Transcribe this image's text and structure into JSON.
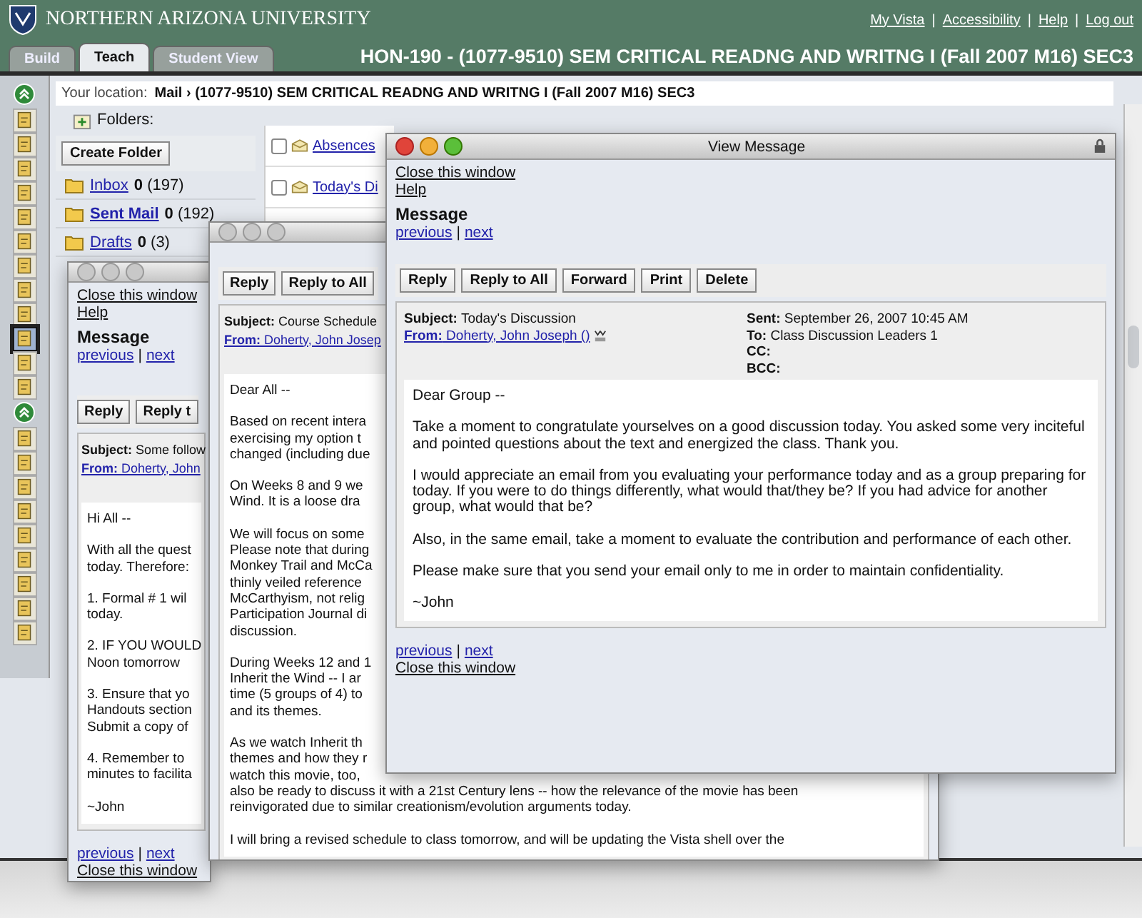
{
  "header": {
    "university": "NORTHERN ARIZONA UNIVERSITY",
    "links": [
      "My Vista",
      "Accessibility",
      "Help",
      "Log out"
    ],
    "link_separator": "|"
  },
  "tabs": [
    {
      "label": "Build",
      "selected": false
    },
    {
      "label": "Teach",
      "selected": true
    },
    {
      "label": "Student View",
      "selected": false
    }
  ],
  "course_title": "HON-190 - (1077-9510) SEM CRITICAL READNG AND WRITNG I (Fall 2007 M16) SEC3",
  "tool_groups": [
    {
      "tools": [
        {
          "selected": false
        },
        {
          "selected": false
        },
        {
          "selected": false
        },
        {
          "selected": false
        },
        {
          "selected": false
        },
        {
          "selected": false
        },
        {
          "selected": false
        },
        {
          "selected": false
        },
        {
          "selected": false
        },
        {
          "selected": true
        },
        {
          "selected": false
        },
        {
          "selected": false
        }
      ]
    },
    {
      "tools": [
        {
          "selected": false
        },
        {
          "selected": false
        },
        {
          "selected": false
        },
        {
          "selected": false
        },
        {
          "selected": false
        },
        {
          "selected": false
        },
        {
          "selected": false
        },
        {
          "selected": false
        },
        {
          "selected": false
        }
      ]
    }
  ],
  "location": {
    "label": "Your location:",
    "path": "Mail › (1077-9510) SEM CRITICAL READNG AND WRITNG I (Fall 2007 M16) SEC3"
  },
  "folders": {
    "label": "Folders:",
    "create_button": "Create Folder",
    "items": [
      {
        "name": "Inbox",
        "unread": "0",
        "total": "(197)",
        "selected": false
      },
      {
        "name": "Sent Mail",
        "unread": "0",
        "total": "(192)",
        "selected": true
      },
      {
        "name": "Drafts",
        "unread": "0",
        "total": "(3)",
        "selected": false
      }
    ]
  },
  "message_list": [
    {
      "subject": "Absences",
      "checked": false
    },
    {
      "subject": "Today's Di",
      "checked": false
    }
  ],
  "windows": [
    {
      "active": false,
      "close_link": "Close this window",
      "help_link": "Help",
      "heading": "Message",
      "nav": {
        "previous": "previous",
        "separator": "|",
        "next": "next"
      },
      "buttons": [
        "Reply",
        "Reply t"
      ],
      "subject_label": "Subject:",
      "subject": "Some follow",
      "from_label": "From:",
      "from": "Doherty, John",
      "paragraphs": [
        [
          "Hi All --"
        ],
        [
          "With all the quest",
          "today. Therefore:"
        ],
        [
          "1. Formal # 1 wil",
          "today."
        ],
        [
          "2. IF YOU WOULD",
          "Noon tomorrow"
        ],
        [
          "3. Ensure that yo",
          "Handouts section",
          "Submit a copy of"
        ],
        [
          "4. Remember to",
          "minutes to facilita"
        ],
        [
          "~John"
        ]
      ],
      "footer": {
        "previous": "previous",
        "separator": "|",
        "next": "next",
        "close_link": "Close this window"
      }
    },
    {
      "active": false,
      "buttons": [
        "Reply",
        "Reply to All"
      ],
      "subject_label": "Subject:",
      "subject": "Course Schedule",
      "from_label": "From:",
      "from": "Doherty, John Josep",
      "paragraphs": [
        [
          "Dear All --"
        ],
        [
          "Based on recent intera",
          "exercising my option t",
          "changed (including due"
        ],
        [
          "On Weeks 8 and 9 we",
          "Wind. It is a loose dra"
        ],
        [
          "We will focus on some",
          "Please note that during",
          "Monkey Trail and McCa",
          "thinly veiled reference",
          "McCarthyism, not relig",
          "Participation Journal di",
          "discussion."
        ],
        [
          "During Weeks 12 and 1",
          "Inherit the Wind -- I ar",
          "time (5 groups of 4) to",
          "and its themes."
        ],
        [
          "As we watch Inherit th",
          "themes and how they r",
          "watch this movie, too,",
          "also be ready to discuss it with a 21st Century lens -- how the relevance of the movie has been",
          "reinvigorated due to similar creationism/evolution arguments today."
        ],
        [
          "I will bring a revised schedule to class tomorrow, and will be updating the Vista shell over the"
        ]
      ]
    },
    {
      "active": true,
      "title": "View Message",
      "close_link": "Close this window",
      "help_link": "Help",
      "heading": "Message",
      "nav": {
        "previous": "previous",
        "separator": "|",
        "next": "next"
      },
      "buttons": [
        "Reply",
        "Reply to All",
        "Forward",
        "Print",
        "Delete"
      ],
      "subject_label": "Subject:",
      "subject": "Today's Discussion",
      "from_label": "From:",
      "from": "Doherty, John Joseph ()",
      "sent_label": "Sent:",
      "sent": "September 26, 2007 10:45 AM",
      "to_label": "To:",
      "to": "Class Discussion Leaders 1",
      "cc_label": "CC:",
      "bcc_label": "BCC:",
      "paragraphs": [
        [
          "Dear Group --"
        ],
        [
          "Take a moment to congratulate yourselves on a good discussion today. You asked some very inciteful and pointed questions about the text and energized the class. Thank you."
        ],
        [
          "I would appreciate an email from you evaluating your performance today and as a group preparing for today. If you were to do things differently, what would that/they be? If you had advice for another group, what would that be?"
        ],
        [
          "Also, in the same email, take a moment to evaluate the contribution and performance of each other."
        ],
        [
          "Please make sure that you send your email only to me in order to maintain confidentiality."
        ],
        [
          "~John"
        ]
      ],
      "footer": {
        "previous": "previous",
        "separator": "|",
        "next": "next",
        "close_link": "Close this window"
      }
    }
  ]
}
